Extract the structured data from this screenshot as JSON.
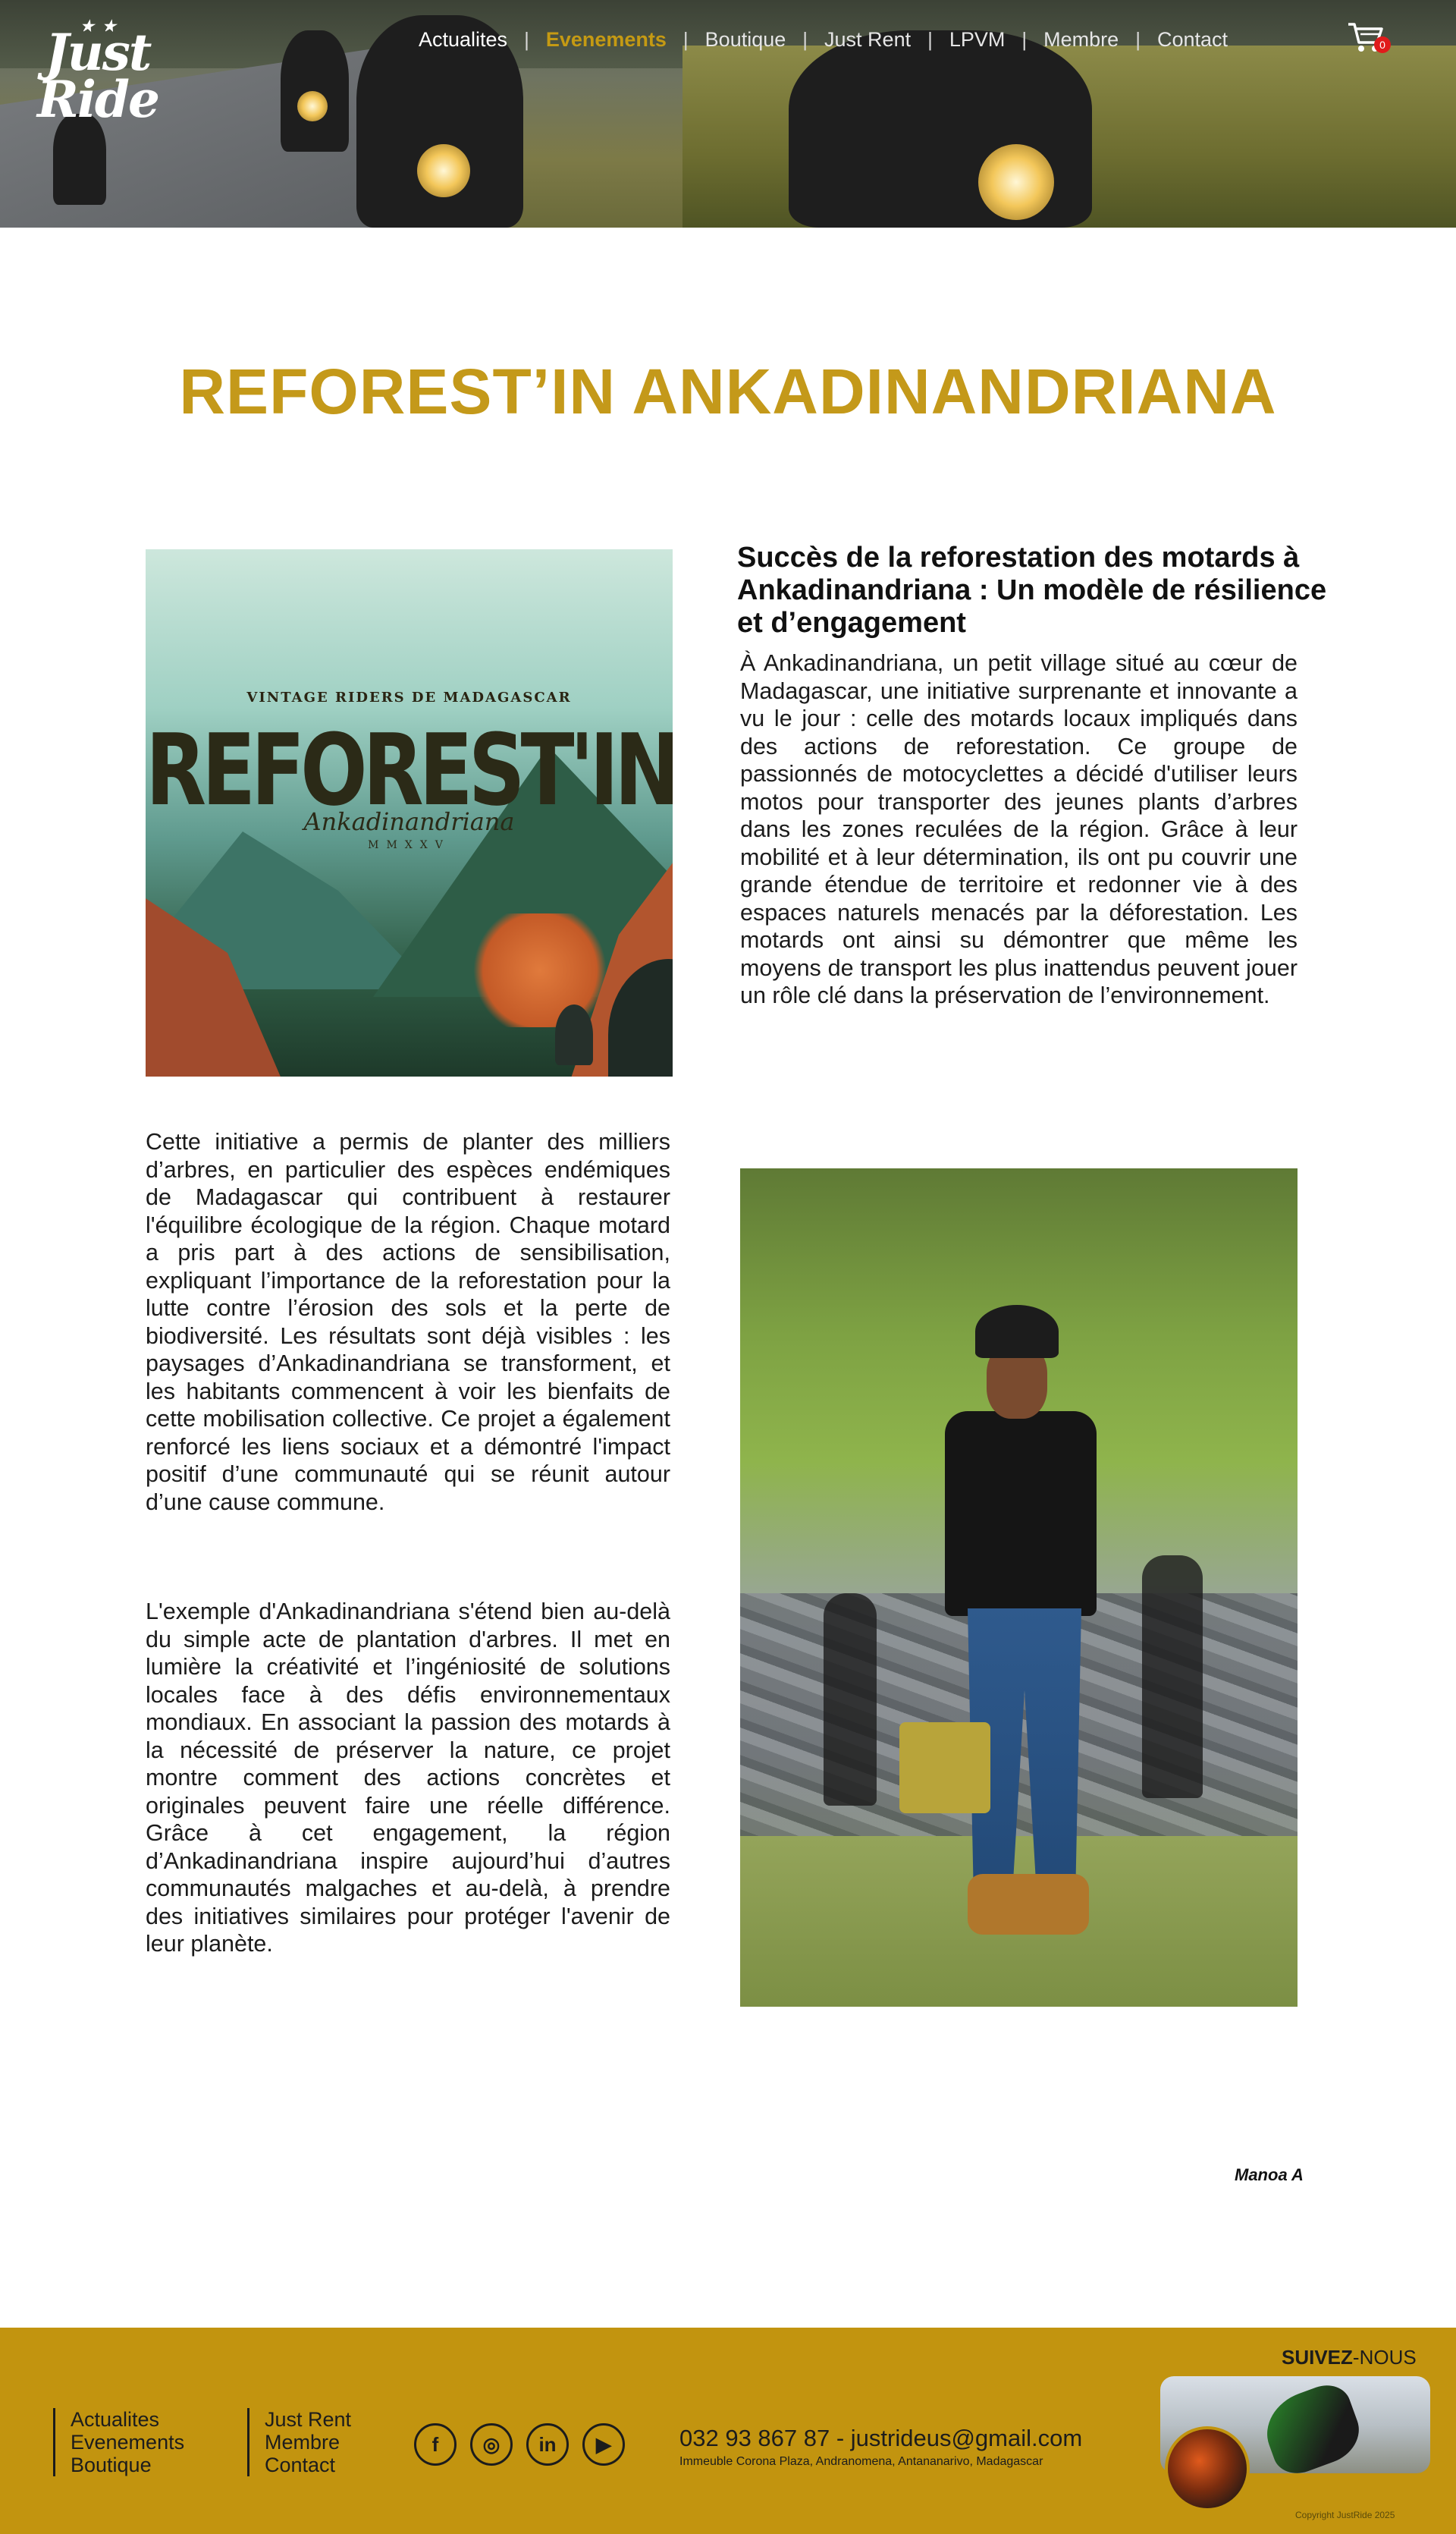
{
  "header": {
    "logo_text": "Just Ride",
    "nav": [
      {
        "label": "Actualites"
      },
      {
        "label": "Evenements"
      },
      {
        "label": "Boutique"
      },
      {
        "label": "Just Rent"
      },
      {
        "label": "LPVM"
      },
      {
        "label": "Membre"
      },
      {
        "label": "Contact"
      }
    ],
    "cart_count": "0",
    "icons": {
      "cart": "cart-icon"
    }
  },
  "article": {
    "title": "REFOREST’IN ANKADINANDRIANA",
    "subheading": "Succès de la reforestation des motards à Ankadinandriana : Un modèle de résilience et d’engagement",
    "paragraph1": "À Ankadinandriana, un petit village situé au cœur de Madagascar, une initiative surprenante et innovante a vu le jour : celle des motards locaux impliqués dans des actions de reforestation. Ce groupe de passionnés de motocyclettes a décidé d'utiliser leurs motos pour transporter des jeunes plants d’arbres dans les zones reculées de la région. Grâce à leur mobilité et à leur détermination, ils ont pu couvrir une grande étendue de territoire et redonner vie à des espaces naturels menacés par la déforestation. Les motards ont ainsi su démontrer que même les moyens de transport les plus inattendus peuvent jouer un rôle clé dans la préservation de l’environnement.",
    "paragraph2": "Cette initiative a permis de planter des milliers d’arbres, en particulier des espèces endémiques de Madagascar qui contribuent à restaurer l'équilibre écologique de la région. Chaque motard a pris part à des actions de sensibilisation, expliquant l’importance de la reforestation pour la lutte contre l’érosion des sols et la perte de biodiversité. Les résultats sont déjà visibles : les paysages d’Ankadinandriana se transforment, et les habitants commencent à voir les bienfaits de cette mobilisation collective. Ce projet a également renforcé les liens sociaux et a démontré l'impact positif d’une communauté qui se réunit autour d’une cause commune.",
    "paragraph3": "L'exemple d'Ankadinandriana s'étend bien au-delà du simple acte de plantation d'arbres. Il met en lumière la créativité et l’ingéniosité de solutions locales face à des défis environnementaux mondiaux. En associant la passion des motards à la nécessité de préserver la nature, ce projet montre comment des actions concrètes et originales peuvent faire une réelle différence. Grâce à cet engagement, la région d’Ankadinandriana inspire aujourd’hui d’autres communautés malgaches et au-delà, à prendre des initiatives similaires pour protéger l'avenir de leur planète.",
    "author": "Manoa A",
    "poster": {
      "brand_top": "VINTAGE RIDERS DE MADAGASCAR",
      "title": "REFOREST'IN",
      "subtitle": "Ankadinandriana",
      "roman": "MMXXV"
    }
  },
  "footer": {
    "col1": [
      "Actualites",
      "Evenements",
      "Boutique"
    ],
    "col2": [
      "Just Rent",
      "Membre",
      "Contact"
    ],
    "social": [
      {
        "icon": "facebook-icon",
        "glyph": "f"
      },
      {
        "icon": "instagram-icon",
        "glyph": "◎"
      },
      {
        "icon": "linkedin-icon",
        "glyph": "in"
      },
      {
        "icon": "youtube-icon",
        "glyph": "▶"
      }
    ],
    "contact_line": "032 93 867 87 - justrideus@gmail.com",
    "address": "Immeuble Corona Plaza, Andranomena, Antananarivo, Madagascar",
    "follow_bold": "SUIVEZ",
    "follow_rest": "-NOUS",
    "copyright": "Copyright JustRide 2025"
  },
  "colors": {
    "accent": "#c4991a",
    "footer_bg": "#c2940f",
    "text": "#1b1b1b"
  }
}
